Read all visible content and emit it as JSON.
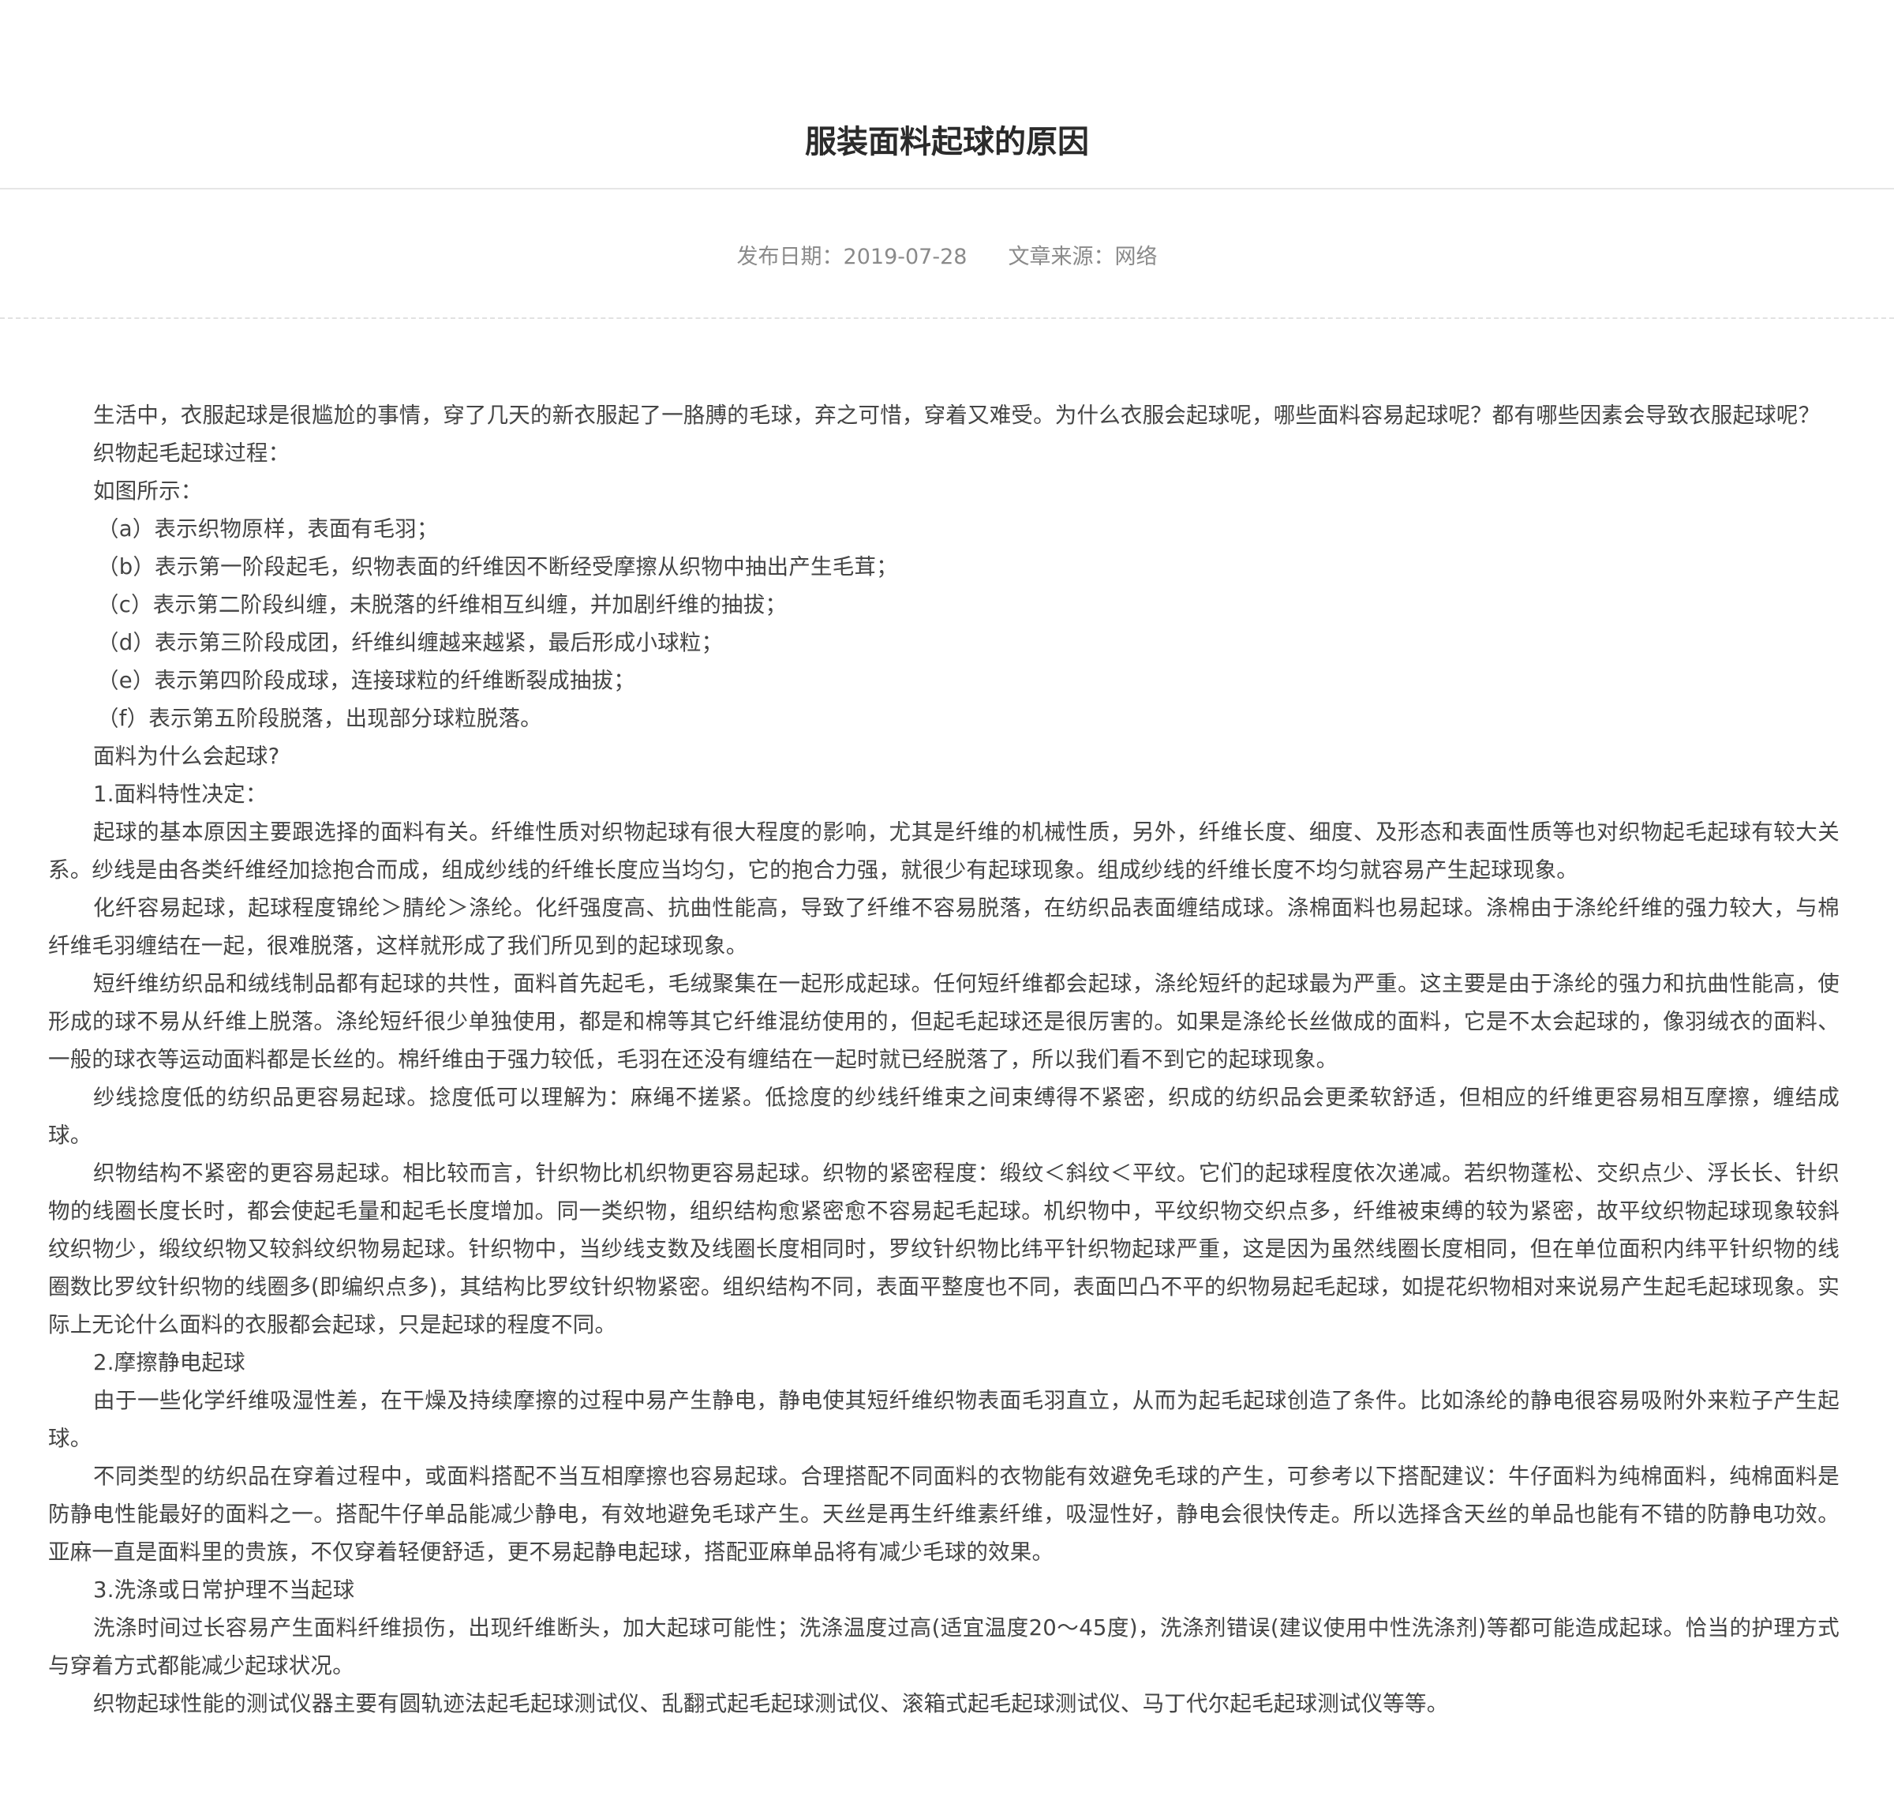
{
  "article": {
    "title": "服装面料起球的原因",
    "meta": {
      "date_label": "发布日期：2019-07-28",
      "source_label": "文章来源：网络"
    },
    "paragraphs": [
      "生活中，衣服起球是很尴尬的事情，穿了几天的新衣服起了一胳膊的毛球，弃之可惜，穿着又难受。为什么衣服会起球呢，哪些面料容易起球呢？都有哪些因素会导致衣服起球呢？",
      "织物起毛起球过程：",
      "如图所示：",
      "（a）表示织物原样，表面有毛羽；",
      "（b）表示第一阶段起毛，织物表面的纤维因不断经受摩擦从织物中抽出产生毛茸；",
      "（c）表示第二阶段纠缠，未脱落的纤维相互纠缠，并加剧纤维的抽拔；",
      "（d）表示第三阶段成团，纤维纠缠越来越紧，最后形成小球粒；",
      "（e）表示第四阶段成球，连接球粒的纤维断裂成抽拔；",
      "（f）表示第五阶段脱落，出现部分球粒脱落。",
      "面料为什么会起球?",
      "1.面料特性决定：",
      "起球的基本原因主要跟选择的面料有关。纤维性质对织物起球有很大程度的影响，尤其是纤维的机械性质，另外，纤维长度、细度、及形态和表面性质等也对织物起毛起球有较大关系。纱线是由各类纤维经加捻抱合而成，组成纱线的纤维长度应当均匀，它的抱合力强，就很少有起球现象。组成纱线的纤维长度不均匀就容易产生起球现象。",
      "化纤容易起球，起球程度锦纶＞腈纶＞涤纶。化纤强度高、抗曲性能高，导致了纤维不容易脱落，在纺织品表面缠结成球。涤棉面料也易起球。涤棉由于涤纶纤维的强力较大，与棉纤维毛羽缠结在一起，很难脱落，这样就形成了我们所见到的起球现象。",
      "短纤维纺织品和绒线制品都有起球的共性，面料首先起毛，毛绒聚集在一起形成起球。任何短纤维都会起球，涤纶短纤的起球最为严重。这主要是由于涤纶的强力和抗曲性能高，使形成的球不易从纤维上脱落。涤纶短纤很少单独使用，都是和棉等其它纤维混纺使用的，但起毛起球还是很厉害的。如果是涤纶长丝做成的面料，它是不太会起球的，像羽绒衣的面料、一般的球衣等运动面料都是长丝的。棉纤维由于强力较低，毛羽在还没有缠结在一起时就已经脱落了，所以我们看不到它的起球现象。",
      "纱线捻度低的纺织品更容易起球。捻度低可以理解为：麻绳不搓紧。低捻度的纱线纤维束之间束缚得不紧密，织成的纺织品会更柔软舒适，但相应的纤维更容易相互摩擦，缠结成球。",
      "织物结构不紧密的更容易起球。相比较而言，针织物比机织物更容易起球。织物的紧密程度：缎纹＜斜纹＜平纹。它们的起球程度依次递减。若织物蓬松、交织点少、浮长长、针织物的线圈长度长时，都会使起毛量和起毛长度增加。同一类织物，组织结构愈紧密愈不容易起毛起球。机织物中，平纹织物交织点多，纤维被束缚的较为紧密，故平纹织物起球现象较斜纹织物少，缎纹织物又较斜纹织物易起球。针织物中，当纱线支数及线圈长度相同时，罗纹针织物比纬平针织物起球严重，这是因为虽然线圈长度相同，但在单位面积内纬平针织物的线圈数比罗纹针织物的线圈多(即编织点多)，其结构比罗纹针织物紧密。组织结构不同，表面平整度也不同，表面凹凸不平的织物易起毛起球，如提花织物相对来说易产生起毛起球现象。实际上无论什么面料的衣服都会起球，只是起球的程度不同。",
      "2.摩擦静电起球",
      "由于一些化学纤维吸湿性差，在干燥及持续摩擦的过程中易产生静电，静电使其短纤维织物表面毛羽直立，从而为起毛起球创造了条件。比如涤纶的静电很容易吸附外来粒子产生起球。",
      "不同类型的纺织品在穿着过程中，或面料搭配不当互相摩擦也容易起球。合理搭配不同面料的衣物能有效避免毛球的产生，可参考以下搭配建议：牛仔面料为纯棉面料，纯棉面料是防静电性能最好的面料之一。搭配牛仔单品能减少静电，有效地避免毛球产生。天丝是再生纤维素纤维，吸湿性好，静电会很快传走。所以选择含天丝的单品也能有不错的防静电功效。亚麻一直是面料里的贵族，不仅穿着轻便舒适，更不易起静电起球，搭配亚麻单品将有减少毛球的效果。",
      "3.洗涤或日常护理不当起球",
      "洗涤时间过长容易产生面料纤维损伤，出现纤维断头，加大起球可能性；洗涤温度过高(适宜温度20～45度)，洗涤剂错误(建议使用中性洗涤剂)等都可能造成起球。恰当的护理方式与穿着方式都能减少起球状况。",
      "织物起球性能的测试仪器主要有圆轨迹法起毛起球测试仪、乱翻式起毛起球测试仪、滚箱式起毛起球测试仪、马丁代尔起毛起球测试仪等等。"
    ]
  }
}
